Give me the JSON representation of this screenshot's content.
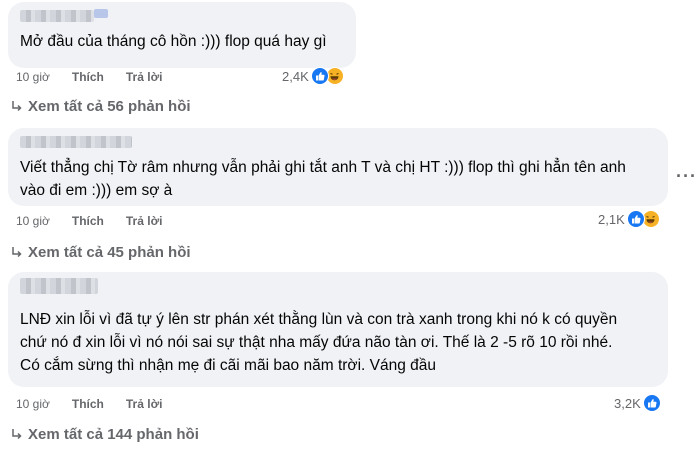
{
  "comments": [
    {
      "text": "Mở đầu của tháng cô hồn :))) flop quá hay gì",
      "time": "10 giờ",
      "like_label": "Thích",
      "reply_label": "Trả lời",
      "reaction_count": "2,4K",
      "reactions": [
        "like-icon",
        "haha-icon"
      ],
      "view_replies": "Xem tất cả 56 phản hồi"
    },
    {
      "text_lines": [
        "Viết thẳng chị Tờ râm nhưng vẫn phải ghi tắt anh T và chị HT :))) flop thì ghi hẳn tên anh",
        "vào đi em :))) em sợ à"
      ],
      "time": "10 giờ",
      "like_label": "Thích",
      "reply_label": "Trả lời",
      "reaction_count": "2,1K",
      "reactions": [
        "like-icon",
        "haha-icon"
      ],
      "view_replies": "Xem tất cả 45 phản hồi"
    },
    {
      "text_lines": [
        "LNĐ xin lỗi vì đã tự ý lên str phán xét thằng lùn và con trà xanh trong khi nó k có quyền",
        "chứ nó đ xin lỗi vì nó nói sai sự thật nha mấy đứa não tàn ơi. Thế là 2 -5 rõ 10 rồi nhé.",
        "Có cắm sừng thì nhận mẹ đi cãi mãi bao năm trời. Váng đầu"
      ],
      "time": "10 giờ",
      "like_label": "Thích",
      "reply_label": "Trả lời",
      "reaction_count": "3,2K",
      "reactions": [
        "like-icon"
      ],
      "view_replies": "Xem tất cả 144 phản hồi"
    }
  ],
  "more_options_icon": "more-horizontal-icon",
  "colors": {
    "bubble": "#f0f2f5",
    "meta": "#65676b",
    "like": "#1877f2",
    "haha": "#f7b125"
  }
}
